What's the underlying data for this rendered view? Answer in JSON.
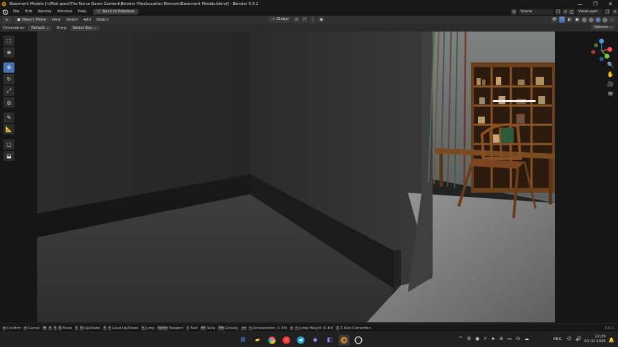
{
  "window": {
    "title": "Basement Models [I:\\Мой диск\\The Nurse Game Content\\Blender Files\\Location Element\\Basement Models.blend] - Blender 5.0.1",
    "controls": [
      "—",
      "❐",
      "✕"
    ]
  },
  "menubar": {
    "items": [
      "File",
      "Edit",
      "Render",
      "Window",
      "Help"
    ],
    "back_button": "Back to Previous",
    "scene_label": "Scene",
    "viewlayer_label": "ViewLayer"
  },
  "viewport_header": {
    "mode": "Object Mode",
    "menus": [
      "View",
      "Select",
      "Add",
      "Object"
    ],
    "orientation_value": "Global"
  },
  "tool_settings": {
    "orientation_label": "Orientation:",
    "orientation_value": "Default",
    "drag_label": "Drag:",
    "drag_value": "Select Box",
    "options_label": "Options"
  },
  "status_bar": {
    "items": [
      {
        "keys": [
          "⌂"
        ],
        "label": "Confirm"
      },
      {
        "keys": [
          "⌂"
        ],
        "label": "Cancel"
      },
      {
        "keys": [
          "W",
          "A",
          "S",
          "D"
        ],
        "label": "Move"
      },
      {
        "keys": [
          "E",
          "Q"
        ],
        "label": "Up/Down"
      },
      {
        "keys": [
          "R",
          "F"
        ],
        "label": "Local Up/Down"
      },
      {
        "keys": [
          "V"
        ],
        "label": "Jump"
      },
      {
        "keys": [
          "Space"
        ],
        "label": "Teleport"
      },
      {
        "keys": [
          "⇧"
        ],
        "label": "Fast"
      },
      {
        "keys": [
          "Alt"
        ],
        "label": "Slow"
      },
      {
        "keys": [
          "Tab"
        ],
        "label": "Gravity"
      },
      {
        "keys": [
          "⌂+",
          "−"
        ],
        "label": "Acceleration (1.33)"
      },
      {
        "keys": [
          "⌂",
          "−"
        ],
        "label": "Jump Height (0.40)"
      },
      {
        "keys": [
          "Z"
        ],
        "label": "Z Axis Correction"
      }
    ],
    "version": "5.0.1"
  },
  "taskbar": {
    "language": "ENG",
    "time": "22:29",
    "date": "03.02.2026"
  },
  "colors": {
    "accent": "#4772b3",
    "header_bg": "#303030",
    "titlebar_bg": "#181818"
  }
}
